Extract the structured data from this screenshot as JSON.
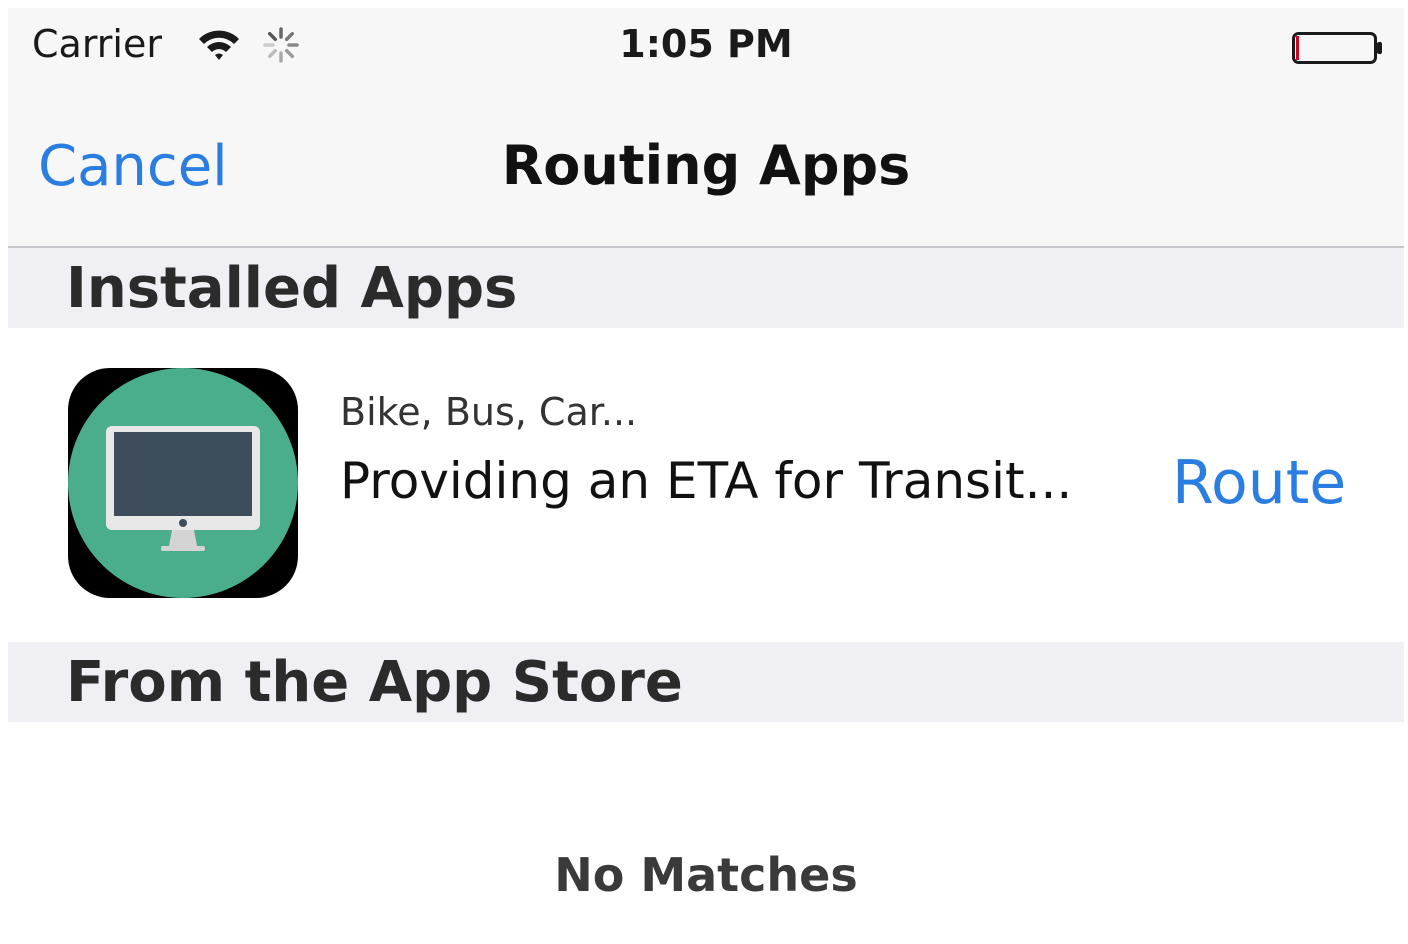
{
  "status_bar": {
    "carrier": "Carrier",
    "time": "1:05 PM",
    "wifi_icon": "wifi-icon",
    "activity_icon": "activity-spinner-icon",
    "battery_icon": "battery-icon"
  },
  "nav": {
    "cancel_label": "Cancel",
    "title": "Routing Apps"
  },
  "sections": {
    "installed_header": "Installed Apps",
    "store_header": "From the App Store"
  },
  "installed_app": {
    "icon": "imac-app-icon",
    "subtitle": "Bike, Bus, Car...",
    "title": "Providing an ETA for Transit...",
    "action_label": "Route"
  },
  "store": {
    "empty_message": "No Matches"
  },
  "colors": {
    "tint": "#2a7de1",
    "bar_background": "#f7f7f7",
    "section_background": "#efeff4",
    "icon_green": "#4aae8c"
  }
}
